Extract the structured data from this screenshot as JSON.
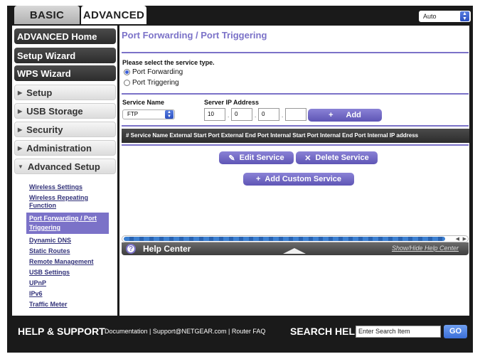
{
  "tabs": {
    "basic": "BASIC",
    "advanced": "ADVANCED"
  },
  "language": {
    "selected": "Auto"
  },
  "sidebar": {
    "main_items": [
      {
        "label": "ADVANCED Home"
      },
      {
        "label": "Setup Wizard"
      },
      {
        "label": "WPS Wizard"
      }
    ],
    "sections": [
      {
        "label": "Setup"
      },
      {
        "label": "USB Storage"
      },
      {
        "label": "Security"
      },
      {
        "label": "Administration"
      },
      {
        "label": "Advanced Setup"
      }
    ],
    "sublinks": [
      {
        "label": "Wireless Settings"
      },
      {
        "label": "Wireless Repeating Function"
      },
      {
        "label": "Port Forwarding / Port Triggering"
      },
      {
        "label": "Dynamic DNS"
      },
      {
        "label": "Static Routes"
      },
      {
        "label": "Remote Management"
      },
      {
        "label": "USB Settings"
      },
      {
        "label": "UPnP"
      },
      {
        "label": "IPv6"
      },
      {
        "label": "Traffic Meter"
      }
    ]
  },
  "main": {
    "title": "Port Forwarding / Port Triggering",
    "service_type_prompt": "Please select the service type.",
    "radio_port_forwarding": "Port Forwarding",
    "radio_port_triggering": "Port Triggering",
    "service_name_label": "Service Name",
    "server_ip_label": "Server IP Address",
    "service_name_value": "FTP",
    "ip_octets": [
      "10",
      "0",
      "0",
      ""
    ],
    "add_button": "Add",
    "table_header": "# Service Name External Start Port External End Port Internal Start Port Internal End Port Internal IP address",
    "edit_service": "Edit Service",
    "delete_service": "Delete Service",
    "add_custom_service": "Add Custom Service"
  },
  "help": {
    "title": "Help Center",
    "toggle": "Show/Hide Help Center"
  },
  "footer": {
    "title": "HELP & SUPPORT",
    "links": "Documentation | Support@NETGEAR.com | Router FAQ",
    "search_label": "SEARCH HELP",
    "search_placeholder": "Enter Search Item",
    "go": "GO"
  }
}
